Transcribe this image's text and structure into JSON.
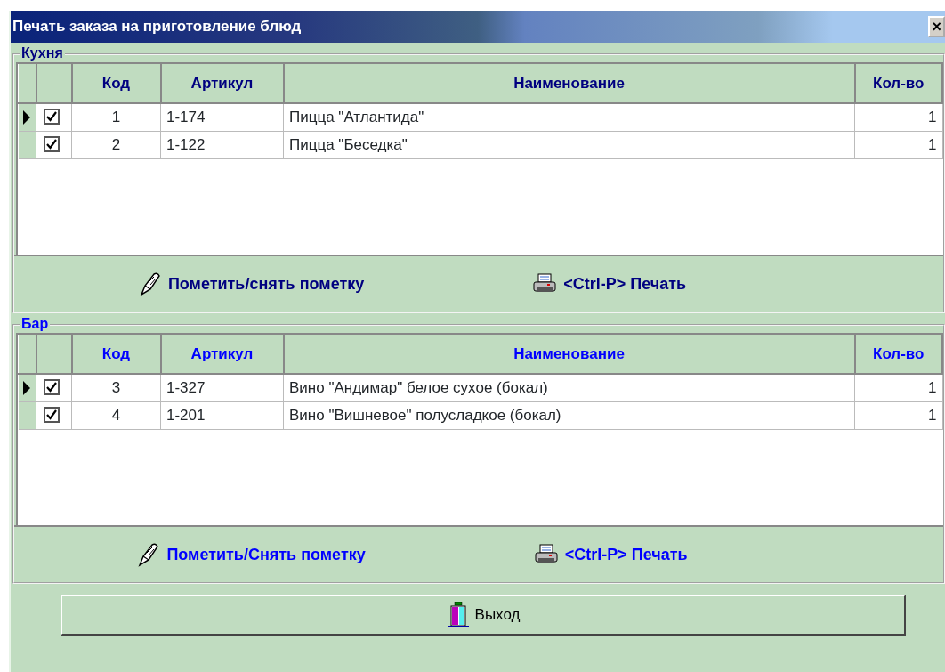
{
  "window": {
    "title": "Печать заказа на приготовление блюд",
    "close": "×"
  },
  "sections": [
    {
      "title": "Кухня",
      "color": "#000080",
      "columns": [
        "Код",
        "Артикул",
        "Наименование",
        "Кол-во"
      ],
      "rows": [
        {
          "selected": true,
          "checked": true,
          "cells": [
            "1",
            "1-174",
            "Пицца \"Атлантида\"",
            "1"
          ]
        },
        {
          "selected": false,
          "checked": true,
          "cells": [
            "2",
            "1-122",
            "Пицца \"Беседка\"",
            "1"
          ]
        }
      ],
      "buttons": [
        {
          "kind": "mark",
          "label": "Пометить/снять пометку"
        },
        {
          "kind": "print",
          "label": "<Ctrl-P> Печать"
        }
      ]
    },
    {
      "title": "Бар",
      "color": "#0000ff",
      "columns": [
        "Код",
        "Артикул",
        "Наименование",
        "Кол-во"
      ],
      "rows": [
        {
          "selected": true,
          "checked": true,
          "cells": [
            "3",
            "1-327",
            "Вино \"Андимар\" белое сухое (бокал)",
            "1"
          ]
        },
        {
          "selected": false,
          "checked": true,
          "cells": [
            "4",
            "1-201",
            "Вино \"Вишневое\" полусладкое (бокал)",
            "1"
          ]
        }
      ],
      "buttons": [
        {
          "kind": "mark",
          "label": "Пометить/Снять пометку"
        },
        {
          "kind": "print",
          "label": "<Ctrl-P> Печать"
        }
      ]
    }
  ],
  "exit_button": "Выход"
}
